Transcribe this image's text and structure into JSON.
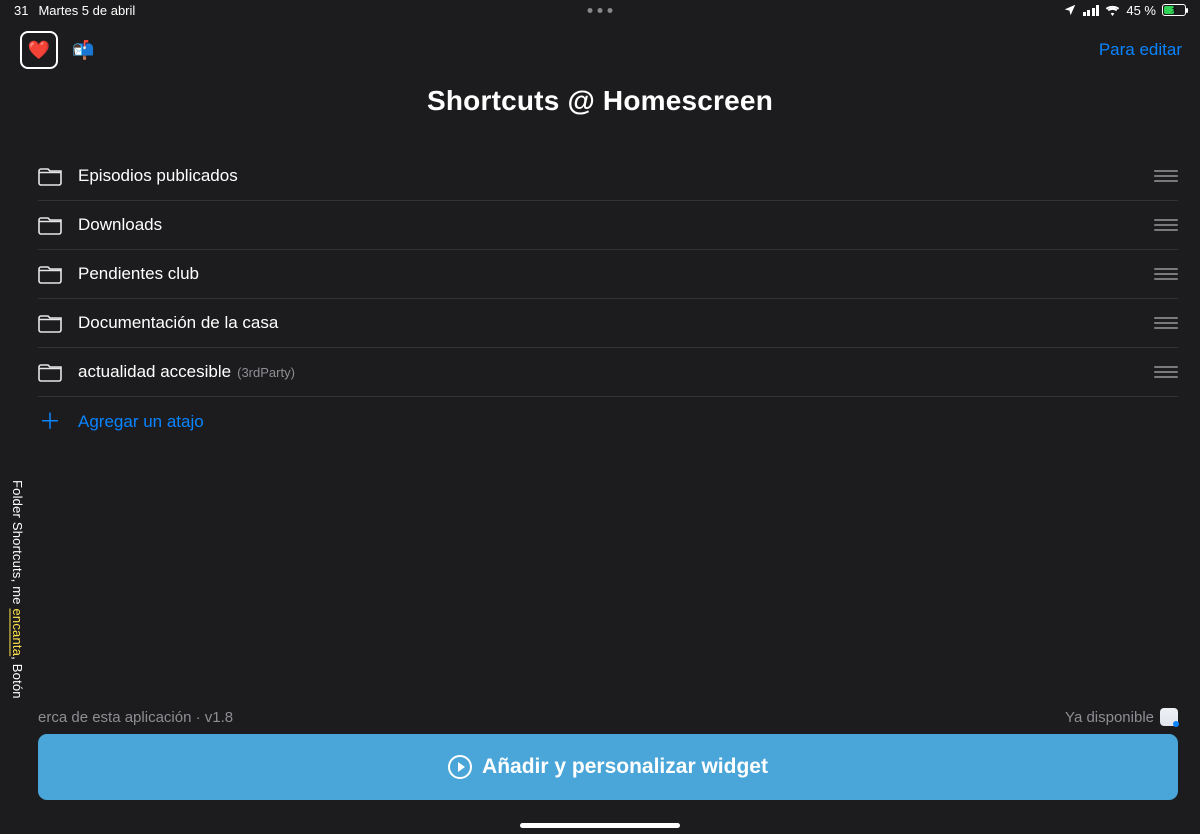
{
  "status": {
    "time_fragment": "31",
    "date": "Martes 5 de abril",
    "battery_pct": "45 %",
    "location_icon": "location",
    "signal_icon": "cellular-signal",
    "wifi_icon": "wifi",
    "charging": true
  },
  "toolbar": {
    "heart_icon": "heart",
    "mailbox_icon": "mailbox",
    "edit_label": "Para editar"
  },
  "page": {
    "title": "Shortcuts @ Homescreen"
  },
  "list": {
    "items": [
      {
        "label": "Episodios publicados",
        "suffix": ""
      },
      {
        "label": "Downloads",
        "suffix": ""
      },
      {
        "label": "Pendientes club",
        "suffix": ""
      },
      {
        "label": "Documentación de la casa",
        "suffix": ""
      },
      {
        "label": "actualidad accesible",
        "suffix": "(3rdParty)"
      }
    ],
    "add_label": "Agregar un atajo"
  },
  "footer": {
    "left_text": "erca de esta aplicación · v1.8",
    "right_text": "Ya disponible"
  },
  "cta": {
    "label": "Añadir y personalizar widget"
  },
  "side_caption": {
    "pre": "Folder Shortcuts, me ",
    "hl": "encanta",
    "post": ", Botón"
  },
  "colors": {
    "bg": "#1c1c1e",
    "accent": "#0a84ff",
    "cta": "#4aa5d8",
    "muted": "#8e8e93"
  }
}
